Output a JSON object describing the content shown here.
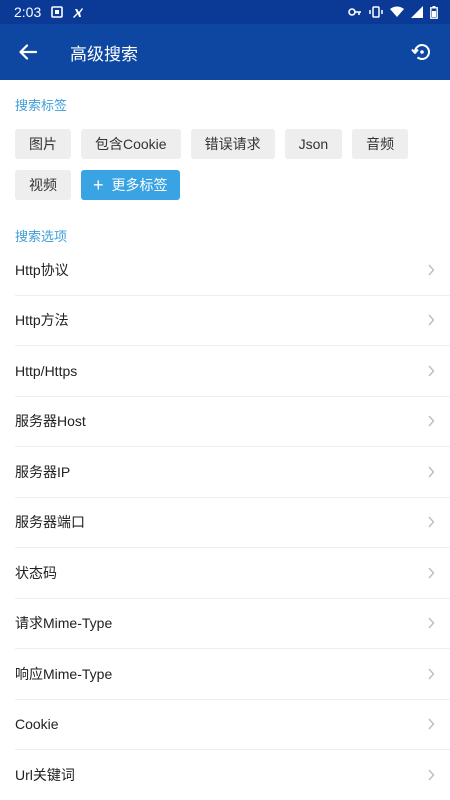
{
  "status_bar": {
    "time": "2:03"
  },
  "app_bar": {
    "title": "高级搜索"
  },
  "tags_section": {
    "title": "搜索标签",
    "tags": [
      "图片",
      "包含Cookie",
      "错误请求",
      "Json",
      "音频",
      "视频"
    ],
    "more_label": "更多标签"
  },
  "options_section": {
    "title": "搜索选项",
    "items": [
      "Http协议",
      "Http方法",
      "Http/Https",
      "服务器Host",
      "服务器IP",
      "服务器端口",
      "状态码",
      "请求Mime-Type",
      "响应Mime-Type",
      "Cookie",
      "Url关键词"
    ]
  },
  "colors": {
    "app_bar": "#0d47a1",
    "status_bar": "#0a3a96",
    "accent": "#3aa3e3",
    "section_title": "#3f9ed8"
  }
}
